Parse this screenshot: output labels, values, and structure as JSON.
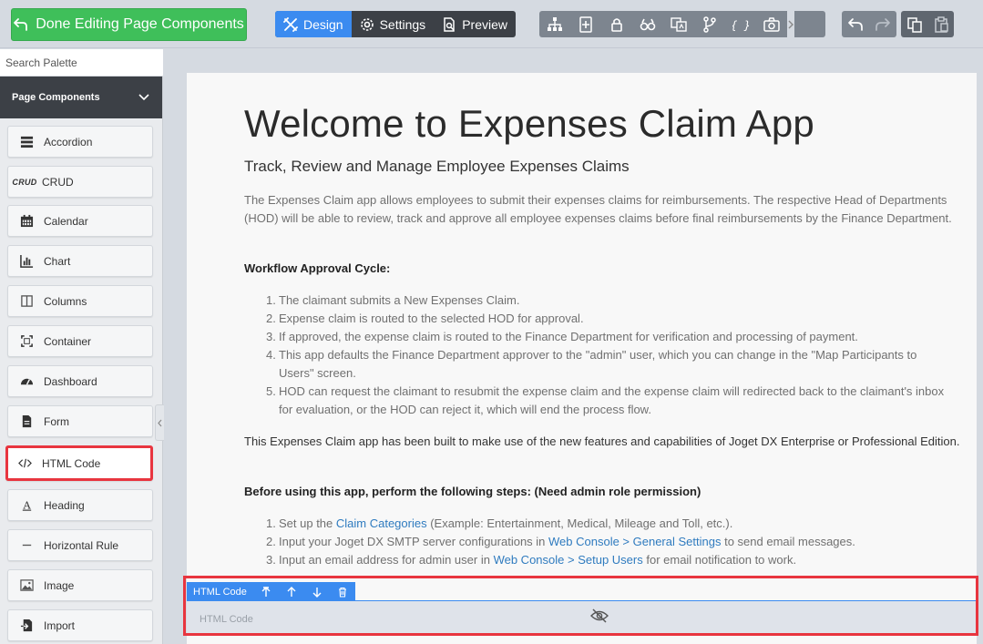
{
  "topbar": {
    "done_label": "Done Editing Page Components",
    "tabs": [
      {
        "label": "Design",
        "icon": "design-icon",
        "active": true
      },
      {
        "label": "Settings",
        "icon": "gear-icon",
        "active": false
      },
      {
        "label": "Preview",
        "icon": "preview-icon",
        "active": false
      }
    ],
    "tools": [
      "tree-icon",
      "insert-element-icon",
      "lock-icon",
      "binoculars-icon",
      "translate-icon",
      "branch-icon",
      "json-icon",
      "screenshot-icon"
    ],
    "history": [
      "undo-icon",
      "redo-icon"
    ],
    "clipboard": [
      "copy-icon",
      "paste-icon"
    ]
  },
  "sidebar": {
    "search_placeholder": "Search Palette",
    "section_label": "Page Components",
    "items": [
      {
        "label": "Accordion",
        "icon": "accordion-icon"
      },
      {
        "label": "CRUD",
        "icon": "crud-icon",
        "icon_text": "CRUD"
      },
      {
        "label": "Calendar",
        "icon": "calendar-icon"
      },
      {
        "label": "Chart",
        "icon": "chart-icon"
      },
      {
        "label": "Columns",
        "icon": "columns-icon"
      },
      {
        "label": "Container",
        "icon": "container-icon"
      },
      {
        "label": "Dashboard",
        "icon": "dashboard-icon"
      },
      {
        "label": "Form",
        "icon": "form-icon"
      },
      {
        "label": "HTML Code",
        "icon": "code-icon",
        "highlighted": true
      },
      {
        "label": "Heading",
        "icon": "heading-icon"
      },
      {
        "label": "Horizontal Rule",
        "icon": "horizontal-rule-icon"
      },
      {
        "label": "Image",
        "icon": "image-icon"
      },
      {
        "label": "Import",
        "icon": "import-icon"
      }
    ]
  },
  "main": {
    "title": "Welcome to Expenses Claim App",
    "subtitle": "Track, Review and Manage Employee Expenses Claims",
    "intro": "The Expenses Claim app allows employees to submit their expenses claims for reimbursements. The respective Head of Departments (HOD) will be able to review, track and approve all employee expenses claims before final reimbursements by the Finance Department.",
    "workflow_heading": "Workflow Approval Cycle:",
    "workflow_steps": [
      "The claimant submits a New Expenses Claim.",
      "Expense claim is routed to the selected HOD for approval.",
      "If approved, the expense claim is routed to the Finance Department for verification and processing of payment.",
      "This app defaults the Finance Department approver to the \"admin\" user, which you can change in the \"Map Participants to Users\" screen.",
      "HOD can request the claimant to resubmit the expense claim and the expense claim will redirected back to the claimant's inbox for evaluation, or the HOD can reject it, which will end the process flow."
    ],
    "built_note": "This Expenses Claim app has been built to make use of the new features and capabilities of Joget DX Enterprise or Professional Edition.",
    "before_heading": "Before using this app, perform the following steps: (Need admin role permission)",
    "setup_steps": [
      {
        "before": "Set up the ",
        "link": "Claim Categories",
        "after": " (Example: Entertainment, Medical, Mileage and Toll, etc.)."
      },
      {
        "before": "Input your Joget DX SMTP server configurations in ",
        "link": "Web Console > General Settings",
        "after": " to send email messages."
      },
      {
        "before": "Input an email address for admin user in ",
        "link": "Web Console > Setup Users",
        "after": " for email notification to work."
      }
    ]
  },
  "selected_element": {
    "label": "HTML Code",
    "actions": [
      "move-up-parent-icon",
      "move-up-icon",
      "move-down-icon",
      "delete-icon"
    ],
    "placeholder": "HTML Code",
    "visibility_icon": "eye-slash-icon"
  }
}
